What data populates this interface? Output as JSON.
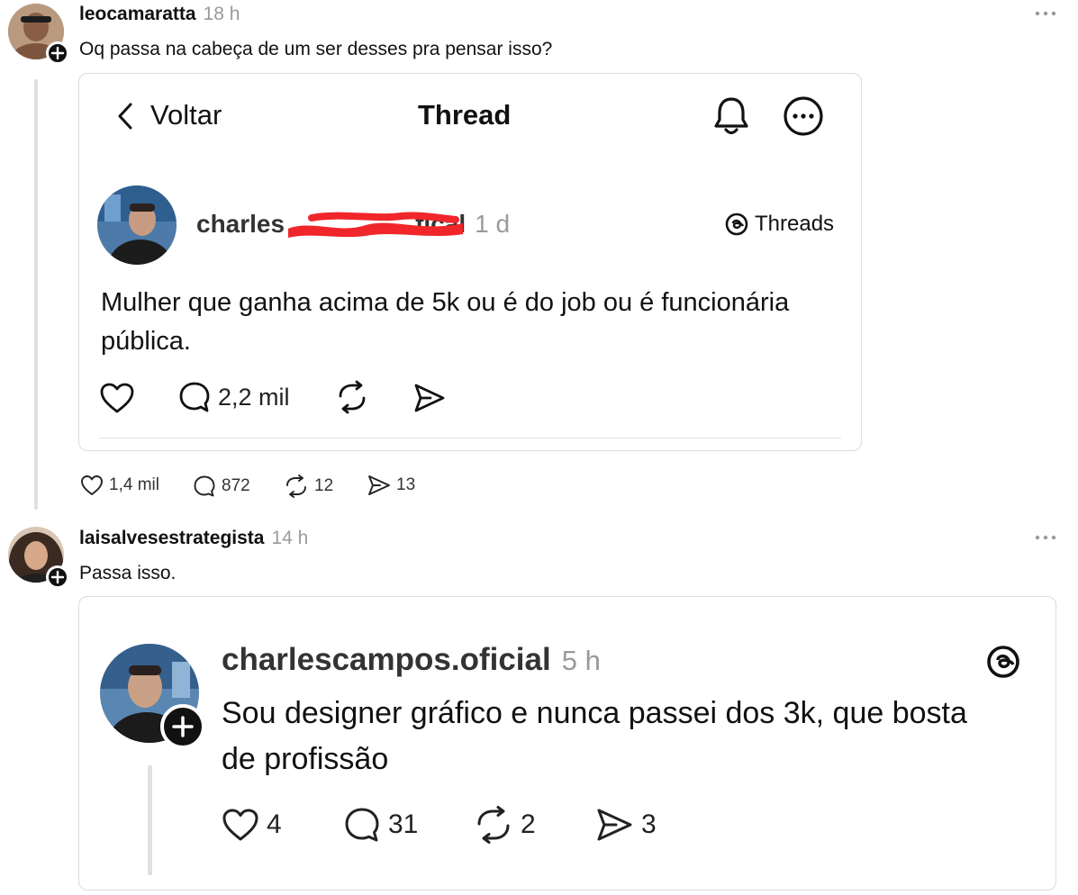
{
  "post1": {
    "username": "leocamaratta",
    "time": "18 h",
    "text": "Oq passa na cabeça de um ser desses pra pensar isso?",
    "more_icon": "more-dots-icon",
    "embed": {
      "back_label": "Voltar",
      "header_title": "Thread",
      "author_visible_start": "charles",
      "author_visible_end": "al",
      "author_fragment": "fic",
      "time": "1 d",
      "brand": "Threads",
      "text": "Mulher que ganha acima de 5k ou é do job ou é funcionária pública.",
      "reply_count": "2,2 mil",
      "redaction_color": "#f0262a"
    },
    "stats": {
      "likes": "1,4 mil",
      "replies": "872",
      "reposts": "12",
      "shares": "13"
    }
  },
  "post2": {
    "username": "laisalvesestrategista",
    "time": "14 h",
    "text": "Passa isso.",
    "embed": {
      "author": "charlescampos.oficial",
      "time": "5 h",
      "text": "Sou designer gráfico e nunca passei dos 3k, que bosta de profissão",
      "likes": "4",
      "replies": "31",
      "reposts": "2",
      "shares": "3"
    }
  },
  "colors": {
    "muted": "#9a9a9a",
    "border": "#dcdcdc",
    "text": "#111111"
  }
}
